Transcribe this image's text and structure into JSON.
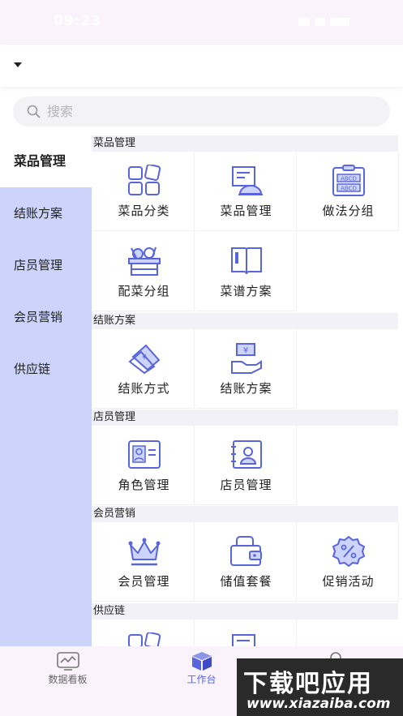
{
  "statusbar": {
    "time": "09:23"
  },
  "search": {
    "placeholder": "搜索"
  },
  "sidebar": {
    "items": [
      {
        "label": "菜品管理",
        "active": true
      },
      {
        "label": "结账方案"
      },
      {
        "label": "店员管理"
      },
      {
        "label": "会员营销"
      },
      {
        "label": "供应链"
      }
    ]
  },
  "sections": [
    {
      "title": "菜品管理",
      "items": [
        {
          "label": "菜品分类",
          "icon": "category-grid-icon"
        },
        {
          "label": "菜品管理",
          "icon": "dish-document-icon"
        },
        {
          "label": "做法分组",
          "icon": "abcd-clipboard-icon"
        },
        {
          "label": "配菜分组",
          "icon": "vegetable-basket-icon"
        },
        {
          "label": "菜谱方案",
          "icon": "open-book-icon"
        }
      ]
    },
    {
      "title": "结账方案",
      "items": [
        {
          "label": "结账方式",
          "icon": "payment-card-icon"
        },
        {
          "label": "结账方案",
          "icon": "yen-hand-icon"
        }
      ]
    },
    {
      "title": "店员管理",
      "items": [
        {
          "label": "角色管理",
          "icon": "id-card-icon"
        },
        {
          "label": "店员管理",
          "icon": "staff-profile-icon"
        }
      ]
    },
    {
      "title": "会员营销",
      "items": [
        {
          "label": "会员管理",
          "icon": "crown-icon"
        },
        {
          "label": "储值套餐",
          "icon": "wallet-icon"
        },
        {
          "label": "促销活动",
          "icon": "discount-badge-icon"
        }
      ]
    },
    {
      "title": "供应链",
      "items": [
        {
          "label": "",
          "icon": "category-grid-icon"
        },
        {
          "label": "",
          "icon": "document-icon"
        }
      ]
    }
  ],
  "tabs": [
    {
      "label": "数据看板",
      "icon": "chart-board-icon"
    },
    {
      "label": "工作台",
      "icon": "cube-icon",
      "active": true
    },
    {
      "label": "",
      "icon": "profile-icon"
    }
  ],
  "watermark": {
    "title": "下载吧应用",
    "url": "www.xiazaiba.com"
  },
  "colors": {
    "accent": "#5865dc",
    "sidebar_bg": "#ccd4fb",
    "section_bg": "#f1f1f7",
    "tabbar_bg": "#fbf3fb"
  }
}
